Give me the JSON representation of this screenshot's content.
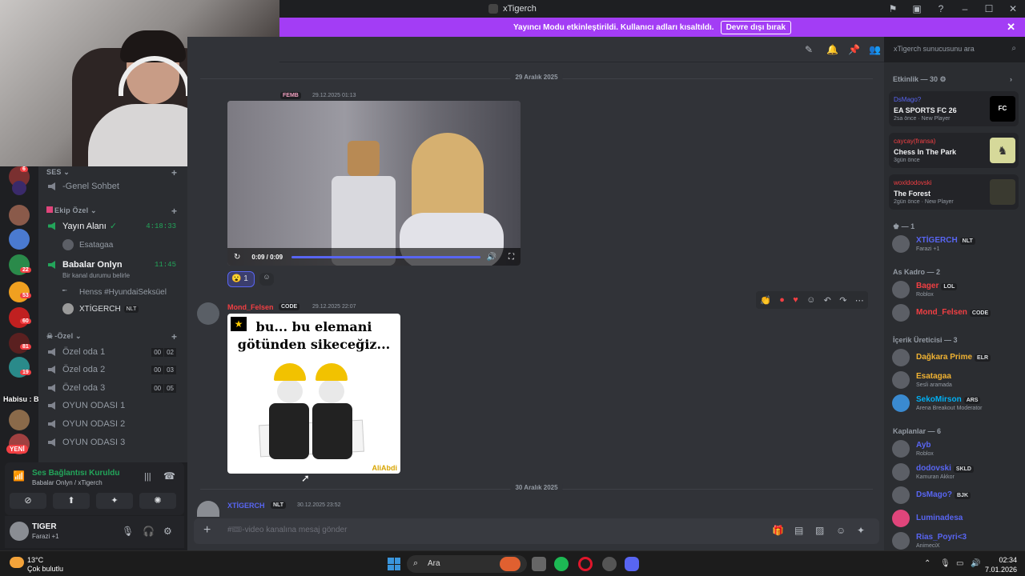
{
  "window": {
    "title": "xTigerch"
  },
  "banner": {
    "text": "Yayıncı Modu etkinleştirildi. Kullanıcı adları kısaltıldı.",
    "button": "Devre dışı bırak"
  },
  "search": {
    "placeholder": "xTigerch sunucusunu ara"
  },
  "guild_badges": [
    "6",
    "22",
    "53",
    "60",
    "81",
    "19"
  ],
  "overlay_text": "Habisu : Ben kaçar ya",
  "new_label": "YENİ",
  "channels": {
    "ses_cat": "SES",
    "genel": "-Genel Sohbet",
    "ekip_cat": "Ekip Özel",
    "yayin": "Yayın Alanı",
    "yayin_time": "4:18:33",
    "esatagaa": "Esatagaa",
    "babalar": "Babalar Onlyn",
    "babalar_time": "11:45",
    "babalar_sub": "Bir kanal durumu belirle",
    "henss": "Henss #HyundaiSeksüel",
    "xtigerch": "XTİGERCH",
    "xtigerch_tag": "NLT",
    "ozel_cat": "-Özel",
    "oda1": "Özel oda 1",
    "oda1_a": "00",
    "oda1_b": "02",
    "oda2": "Özel oda 2",
    "oda2_a": "00",
    "oda2_b": "03",
    "oda3": "Özel oda 3",
    "oda3_a": "00",
    "oda3_b": "05",
    "oyun1": "OYUN ODASI 1",
    "oyun2": "OYUN ODASI 2",
    "oyun3": "OYUN ODASI 3"
  },
  "voice": {
    "status": "Ses Bağlantısı Kuruldu",
    "sub": "Babalar Onlyn / xTigerch"
  },
  "user": {
    "name": "TIGER",
    "status": "Farazi +1"
  },
  "messages": {
    "date1": "29 Aralık 2025",
    "m1_tag": "FEMB",
    "m1_time": "29.12.2025 01:13",
    "video_time": "0:09 / 0:09",
    "reaction_count": "1",
    "m2_name": "Mond_Felsen",
    "m2_tag": "CODE",
    "m2_time": "29.12.2025 22:07",
    "gif_caption_1": "bu... bu elemani",
    "gif_caption_2": "götünden sikeceğiz...",
    "gif_watermark": "AliAbdi",
    "date2": "30 Aralık 2025",
    "m3_name": "XTİGERCH",
    "m3_tag": "NLT",
    "m3_time": "30.12.2025 23:52"
  },
  "input": {
    "placeholder": "#🎟-video kanalına mesaj gönder"
  },
  "members": {
    "activity_head": "Etkinlik — 30",
    "cards": [
      {
        "user": "DsMago?",
        "game": "EA SPORTS FC 26",
        "meta": "2sa önce · New Player"
      },
      {
        "user": "caycay(fransa)",
        "game": "Chess In The Park",
        "meta": "3gün önce"
      },
      {
        "user": "woxldodovski",
        "game": "The Forest",
        "meta": "2gün önce · New Player"
      }
    ],
    "g1_head": "— 1",
    "g1": [
      {
        "name": "XTİGERCH",
        "tag": "NLT",
        "sub": "Farazi +1"
      }
    ],
    "g2_head": "As Kadro — 2",
    "g2": [
      {
        "name": "Bager",
        "tag": "LOL",
        "sub": "Roblox"
      },
      {
        "name": "Mond_Felsen",
        "tag": "CODE",
        "sub": ""
      }
    ],
    "g3_head": "İçerik Üreticisi — 3",
    "g3": [
      {
        "name": "Dağkara Prime",
        "tag": "ELR",
        "sub": ""
      },
      {
        "name": "Esatagaa",
        "tag": "",
        "sub": "Sesli aramada"
      },
      {
        "name": "SekoMirson",
        "tag": "ARS",
        "sub": "Arena Breakout Moderator"
      }
    ],
    "g4_head": "Kaplanlar — 6",
    "g4": [
      {
        "name": "Ayb",
        "tag": "",
        "sub": "Roblox"
      },
      {
        "name": "dodovski",
        "tag": "SKLD",
        "sub": "Kamuran Akkor"
      },
      {
        "name": "DsMago?",
        "tag": "BJK",
        "sub": ""
      },
      {
        "name": "Luminadesa",
        "tag": "",
        "sub": ""
      },
      {
        "name": "Rias_Poyri<3",
        "tag": "",
        "sub": "AnimeciX"
      }
    ]
  },
  "taskbar": {
    "weather_temp": "13°C",
    "weather_desc": "Çok bulutlu",
    "search": "Ara",
    "time": "02:34",
    "date": "7.01.2026"
  },
  "colors": {
    "accent": "#5865f2",
    "banner": "#a33df5",
    "online": "#23a55a",
    "red_name": "#f23f43"
  }
}
